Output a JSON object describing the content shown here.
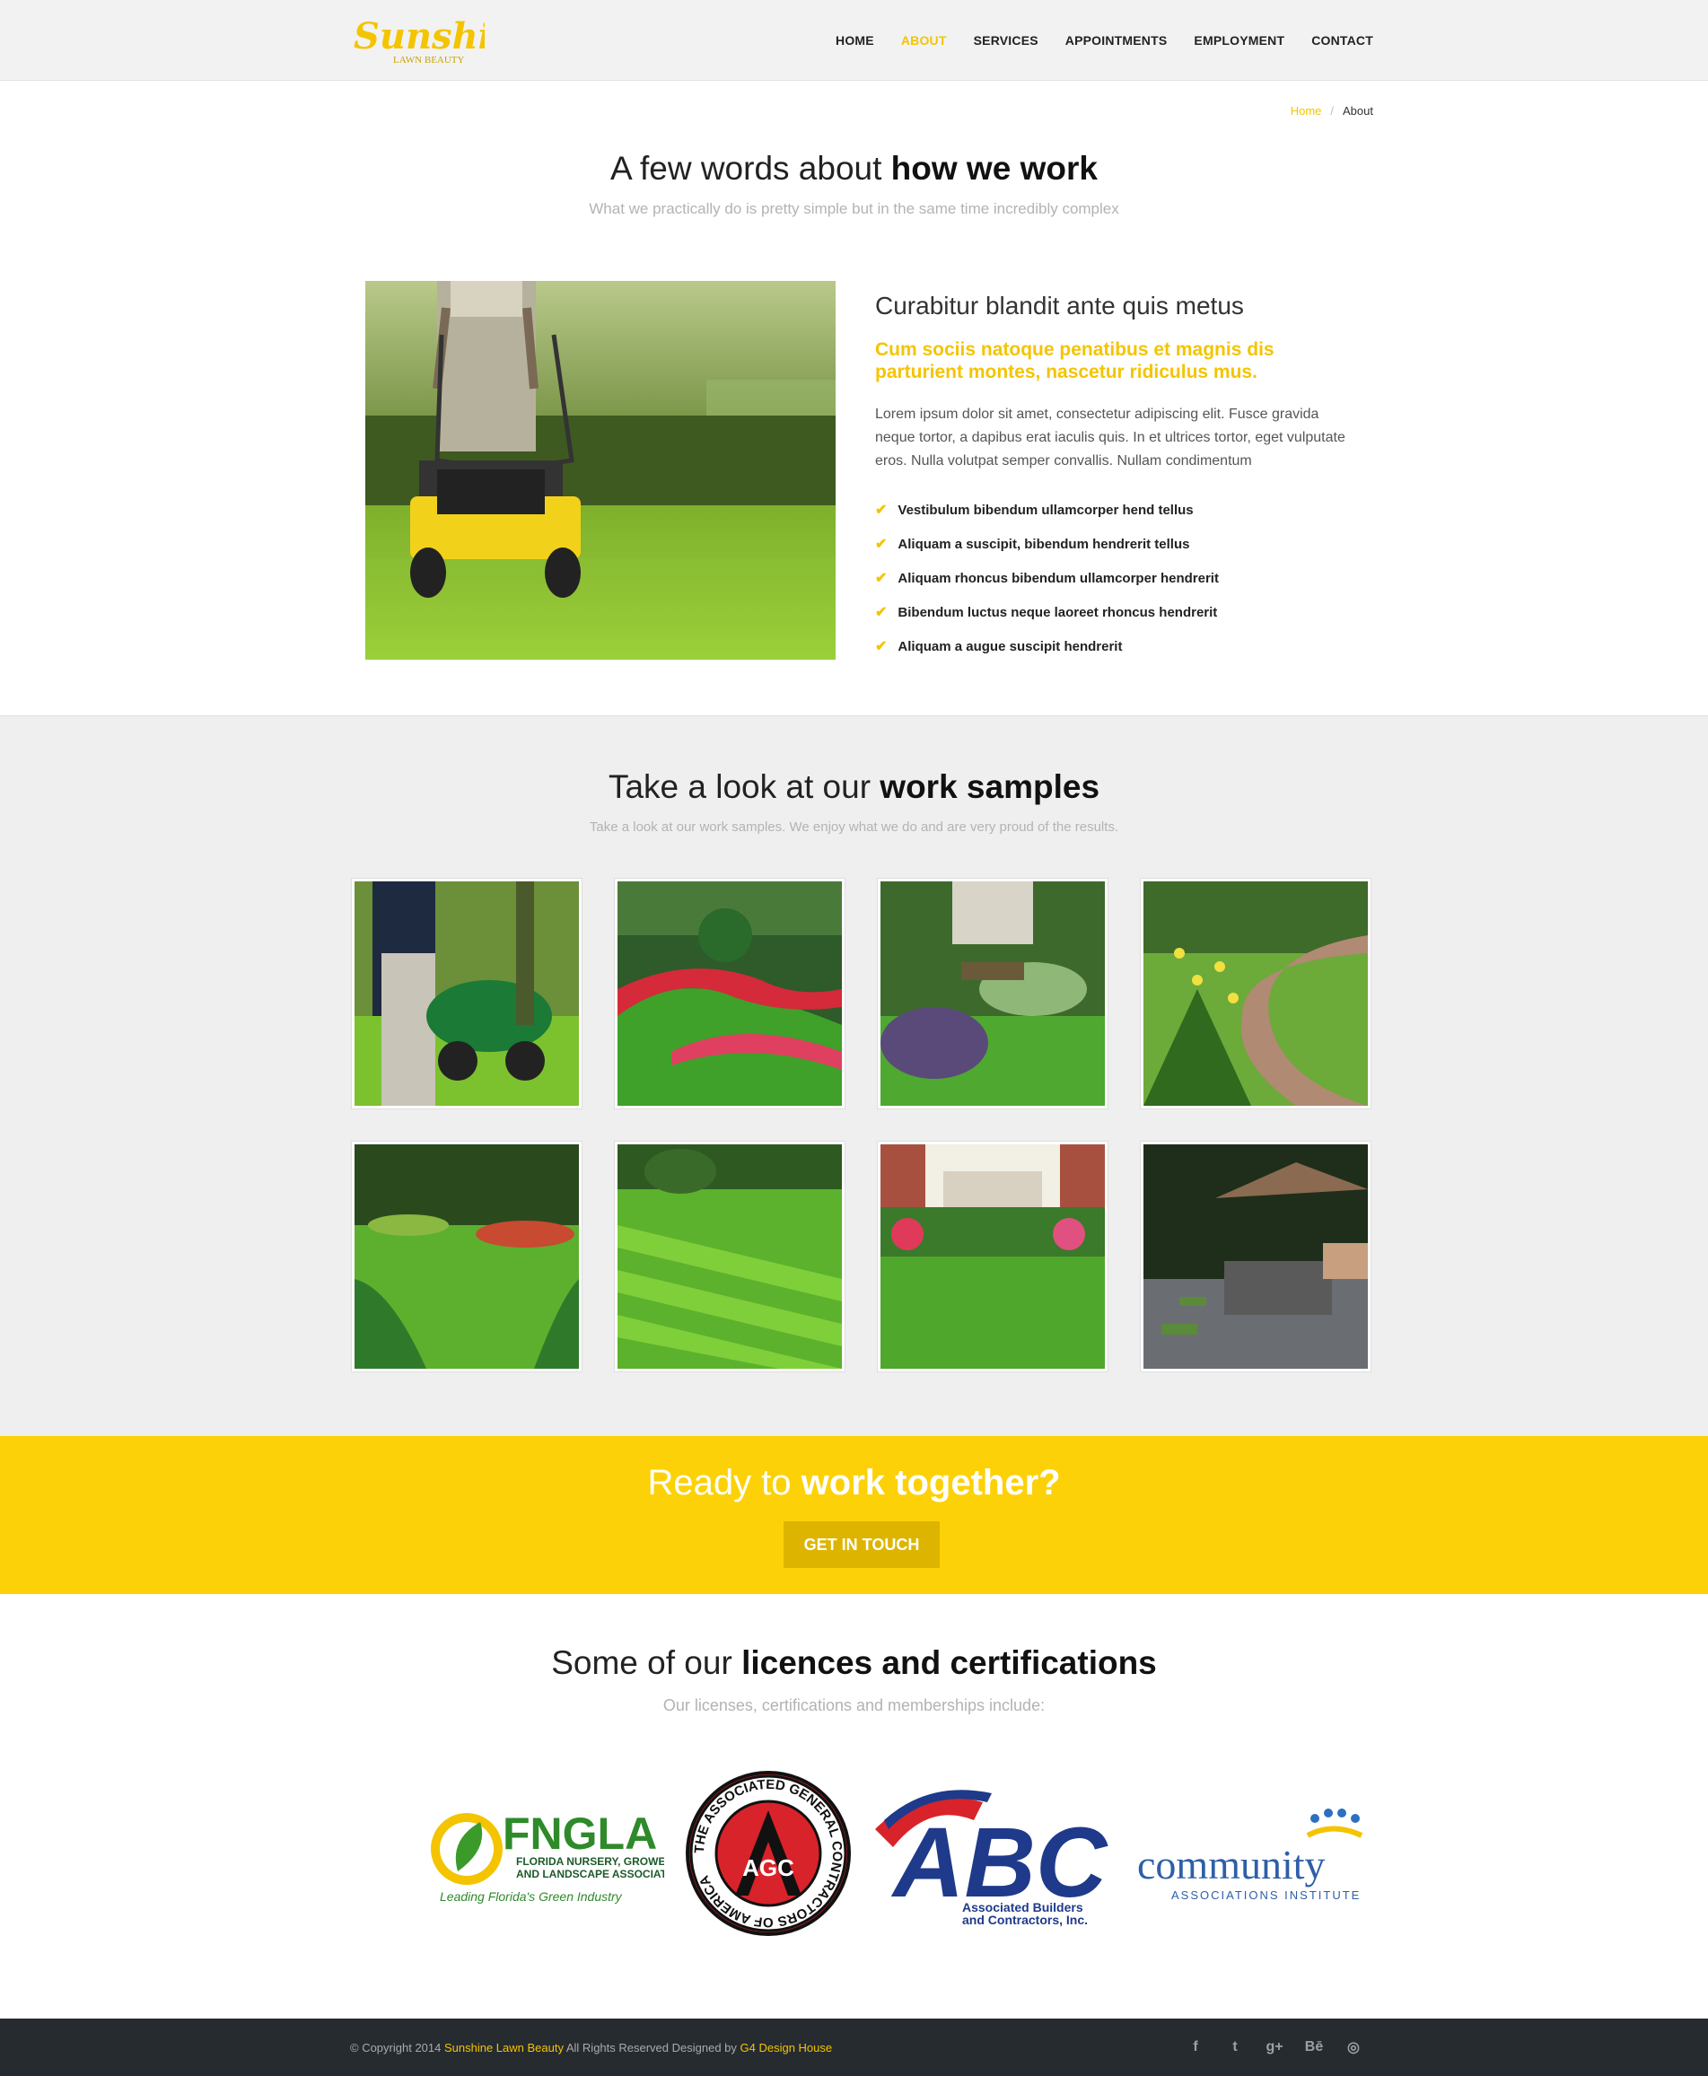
{
  "header": {
    "logo_main": "Sunshine",
    "logo_sub": "LAWN BEAUTY",
    "nav": [
      {
        "label": "HOME"
      },
      {
        "label": "ABOUT",
        "active": true
      },
      {
        "label": "SERVICES"
      },
      {
        "label": "APPOINTMENTS"
      },
      {
        "label": "EMPLOYMENT"
      },
      {
        "label": "CONTACT"
      }
    ]
  },
  "breadcrumb": {
    "home": "Home",
    "sep": "/",
    "current": "About"
  },
  "about": {
    "title_light": "A few words about ",
    "title_bold": "how we work",
    "subtitle": "What we practically do is pretty simple but in the same time incredibly complex",
    "heading": "Curabitur blandit ante quis metus",
    "highlight": "Cum sociis natoque penatibus et magnis dis parturient montes, nascetur ridiculus mus.",
    "paragraph": "Lorem ipsum dolor sit amet, consectetur adipiscing elit. Fusce gravida neque tortor, a dapibus erat iaculis quis. In et ultrices tortor, eget vulputate eros. Nulla volutpat semper convallis. Nullam condimentum",
    "list": [
      "Vestibulum bibendum ullamcorper hend tellus",
      "Aliquam a suscipit, bibendum hendrerit tellus",
      "Aliquam rhoncus bibendum ullamcorper hendrerit",
      "Bibendum luctus neque laoreet rhoncus hendrerit",
      "Aliquam a augue suscipit hendrerit"
    ]
  },
  "works": {
    "title_light": "Take a look at our ",
    "title_bold": "work samples",
    "subtitle": "Take a look at our work samples. We enjoy what we do and are very proud of the results."
  },
  "cta": {
    "title_light": "Ready to ",
    "title_bold": "work together?",
    "button": "GET IN TOUCH"
  },
  "licences": {
    "title_light": "Some of our ",
    "title_bold": "licences and certifications",
    "subtitle": "Our licenses, certifications and memberships include:",
    "fngla": {
      "name": "FNGLA",
      "line1": "FLORIDA NURSERY, GROWERS",
      "line2": "AND LANDSCAPE ASSOCIATION",
      "tag": "Leading Florida's Green Industry"
    },
    "agc": {
      "ring": "THE ASSOCIATED GENERAL CONTRACTORS OF AMERICA",
      "mark": "AGC"
    },
    "abc": {
      "name": "ABC",
      "line1": "Associated Builders",
      "line2": "and Contractors, Inc."
    },
    "cai": {
      "name": "community",
      "sub": "ASSOCIATIONS INSTITUTE"
    }
  },
  "footer": {
    "pre": "© Copyright 2014 ",
    "brand": "Sunshine Lawn Beauty",
    "mid": " All Rights Reserved Designed by ",
    "designer": "G4 Design House",
    "social": [
      "f",
      "t",
      "g+",
      "Bē",
      "◎"
    ]
  },
  "colors": {
    "accent": "#f4c400",
    "cta": "#fdd107",
    "footer": "#262b30"
  }
}
